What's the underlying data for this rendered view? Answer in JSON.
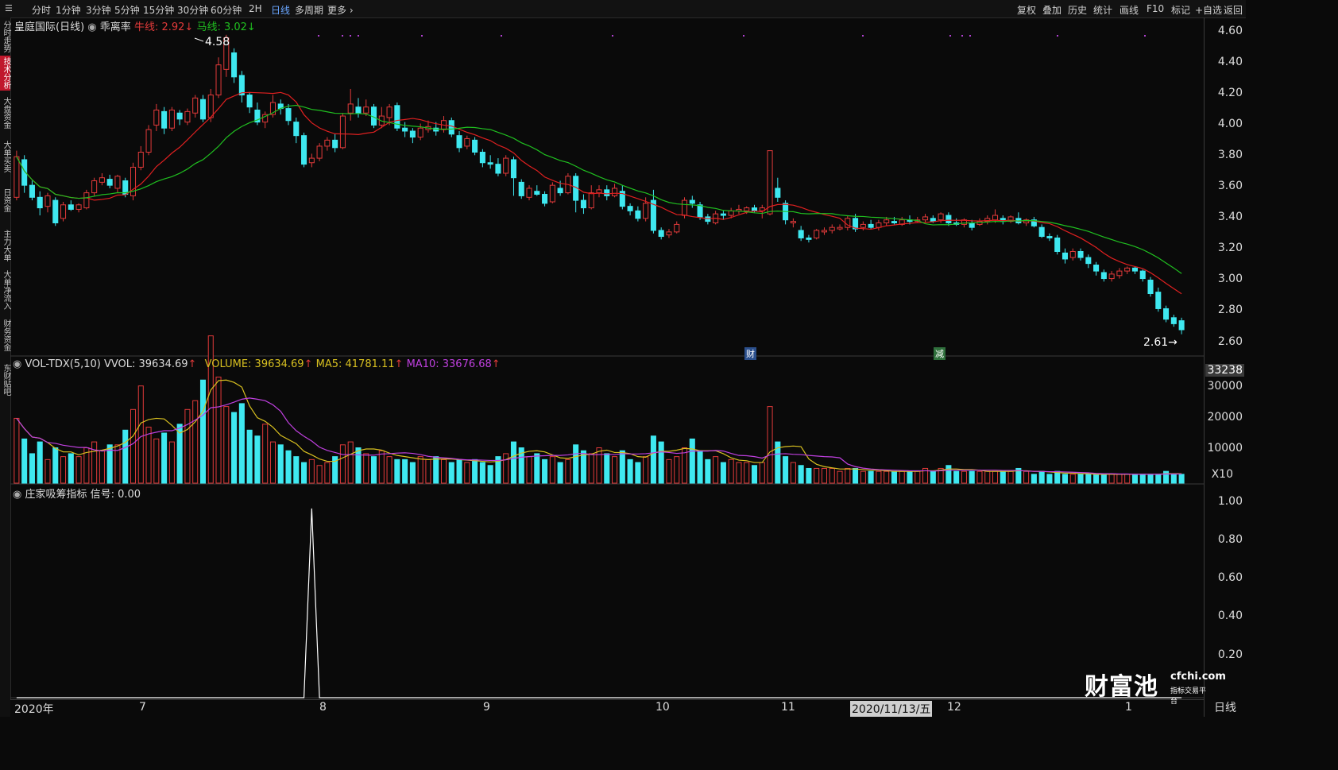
{
  "toolbar": {
    "periods": [
      "分时",
      "1分钟",
      "3分钟",
      "5分钟",
      "15分钟",
      "30分钟",
      "60分钟",
      "2H",
      "日线",
      "多周期",
      "更多"
    ],
    "active_period": "日线",
    "actions": [
      "复权",
      "叠加",
      "历史",
      "统计",
      "画线",
      "F10",
      "标记",
      "+自选",
      "返回"
    ]
  },
  "sidebar": {
    "items": [
      "分时走势",
      "技术分析",
      "大盘资金",
      "大单买卖",
      "日资金",
      "主力大单",
      "大单净流入",
      "财务资金",
      "东财贴吧"
    ],
    "active": "技术分析"
  },
  "main_pane": {
    "stock_title": "皇庭国际(日线)",
    "indicator_name": "乖离率",
    "bull_label": "牛线: 2.92",
    "bull_arrow": "↓",
    "horse_label": "马线: 3.02",
    "horse_arrow": "↓",
    "high_marker": "4.58",
    "low_marker": "2.61",
    "event_badge_1": "财",
    "event_badge_2": "减"
  },
  "volume_pane": {
    "label_main": "VOL-TDX(5,10) VVOL: 39634.69",
    "label_volume": "VOLUME: 39634.69",
    "label_ma5": "MA5: 41781.11",
    "label_ma10": "MA10: 33676.68",
    "up_arrow": "↑",
    "axis_top_value": "33238",
    "axis_labels": [
      "30000",
      "20000",
      "10000",
      "X10"
    ]
  },
  "signal_pane": {
    "label": "庄家吸筹指标 信号: 0.00",
    "axis_labels": [
      "1.00",
      "0.80",
      "0.60",
      "0.40",
      "0.20"
    ]
  },
  "price_axis": [
    "4.60",
    "4.40",
    "4.20",
    "4.00",
    "3.80",
    "3.60",
    "3.40",
    "3.20",
    "3.00",
    "2.80",
    "2.60"
  ],
  "date_axis": [
    "2020年",
    "7",
    "8",
    "9",
    "10",
    "11",
    "12",
    "1"
  ],
  "date_cursor": "2020/11/13/五",
  "right_tab": "日线",
  "watermark": {
    "brand": "财富池",
    "url": "cfchi.com",
    "tagline": "指标交易平台"
  },
  "colors": {
    "up": "#e23a3a",
    "down": "#3fe8f0",
    "ma_short": "#e02020",
    "ma_long": "#20c020",
    "vol_ma5": "#d8c020",
    "vol_ma10": "#c040e0"
  },
  "chart_data": {
    "type": "candlestick",
    "price_range": [
      2.55,
      4.62
    ],
    "bull_line_last": 2.92,
    "horse_line_last": 3.02,
    "candles": [
      [
        3.52,
        3.79,
        3.83,
        3.5
      ],
      [
        3.77,
        3.6,
        3.8,
        3.55
      ],
      [
        3.6,
        3.52,
        3.63,
        3.5
      ],
      [
        3.52,
        3.45,
        3.56,
        3.4
      ],
      [
        3.46,
        3.53,
        3.55,
        3.42
      ],
      [
        3.5,
        3.35,
        3.52,
        3.33
      ],
      [
        3.38,
        3.47,
        3.49,
        3.36
      ],
      [
        3.47,
        3.44,
        3.5,
        3.43
      ],
      [
        3.44,
        3.47,
        3.48,
        3.42
      ],
      [
        3.45,
        3.55,
        3.57,
        3.44
      ],
      [
        3.55,
        3.63,
        3.65,
        3.53
      ],
      [
        3.62,
        3.65,
        3.68,
        3.6
      ],
      [
        3.64,
        3.6,
        3.67,
        3.58
      ],
      [
        3.58,
        3.66,
        3.67,
        3.55
      ],
      [
        3.63,
        3.54,
        3.65,
        3.52
      ],
      [
        3.53,
        3.72,
        3.75,
        3.5
      ],
      [
        3.72,
        3.82,
        3.86,
        3.7
      ],
      [
        3.82,
        3.97,
        4.0,
        3.8
      ],
      [
        4.0,
        4.1,
        4.14,
        3.96
      ],
      [
        4.09,
        3.98,
        4.12,
        3.94
      ],
      [
        3.98,
        4.1,
        4.12,
        3.96
      ],
      [
        4.08,
        4.04,
        4.1,
        4.0
      ],
      [
        4.02,
        4.09,
        4.11,
        4.0
      ],
      [
        4.08,
        4.18,
        4.2,
        4.05
      ],
      [
        4.17,
        4.04,
        4.2,
        4.02
      ],
      [
        4.05,
        4.2,
        4.24,
        4.02
      ],
      [
        4.2,
        4.4,
        4.45,
        4.18
      ],
      [
        4.37,
        4.58,
        4.6,
        4.32
      ],
      [
        4.48,
        4.32,
        4.51,
        4.28
      ],
      [
        4.33,
        4.2,
        4.36,
        4.15
      ],
      [
        4.2,
        4.12,
        4.22,
        4.08
      ],
      [
        4.1,
        4.02,
        4.15,
        4.0
      ],
      [
        4.02,
        4.07,
        4.09,
        3.98
      ],
      [
        4.07,
        4.15,
        4.2,
        4.05
      ],
      [
        4.14,
        4.11,
        4.17,
        4.07
      ],
      [
        4.11,
        4.03,
        4.14,
        4.0
      ],
      [
        4.02,
        3.93,
        4.05,
        3.88
      ],
      [
        3.93,
        3.74,
        3.95,
        3.72
      ],
      [
        3.75,
        3.78,
        3.81,
        3.72
      ],
      [
        3.78,
        3.86,
        3.88,
        3.76
      ],
      [
        3.86,
        3.9,
        3.92,
        3.83
      ],
      [
        3.9,
        3.85,
        3.94,
        3.82
      ],
      [
        3.85,
        4.06,
        4.08,
        3.84
      ],
      [
        4.08,
        4.14,
        4.24,
        4.03
      ],
      [
        4.12,
        4.08,
        4.18,
        4.05
      ],
      [
        4.08,
        4.12,
        4.17,
        4.06
      ],
      [
        4.12,
        4.0,
        4.14,
        3.98
      ],
      [
        4.0,
        4.06,
        4.12,
        3.98
      ],
      [
        4.05,
        4.12,
        4.14,
        4.0
      ],
      [
        4.13,
        3.98,
        4.15,
        3.96
      ],
      [
        3.98,
        3.96,
        4.02,
        3.92
      ],
      [
        3.96,
        3.92,
        3.98,
        3.88
      ],
      [
        3.92,
        3.98,
        4.01,
        3.9
      ],
      [
        3.97,
        3.99,
        4.03,
        3.95
      ],
      [
        3.98,
        3.96,
        4.02,
        3.93
      ],
      [
        3.97,
        4.03,
        4.06,
        3.95
      ],
      [
        4.03,
        3.94,
        4.05,
        3.92
      ],
      [
        3.93,
        3.85,
        3.96,
        3.82
      ],
      [
        3.86,
        3.91,
        3.93,
        3.84
      ],
      [
        3.9,
        3.82,
        3.92,
        3.8
      ],
      [
        3.82,
        3.75,
        3.84,
        3.72
      ],
      [
        3.75,
        3.74,
        3.8,
        3.71
      ],
      [
        3.74,
        3.68,
        3.78,
        3.66
      ],
      [
        3.68,
        3.78,
        3.8,
        3.66
      ],
      [
        3.77,
        3.65,
        3.79,
        3.53
      ],
      [
        3.62,
        3.53,
        3.64,
        3.51
      ],
      [
        3.52,
        3.58,
        3.6,
        3.5
      ],
      [
        3.56,
        3.54,
        3.6,
        3.53
      ],
      [
        3.54,
        3.48,
        3.56,
        3.46
      ],
      [
        3.49,
        3.6,
        3.62,
        3.48
      ],
      [
        3.58,
        3.55,
        3.63,
        3.53
      ],
      [
        3.55,
        3.66,
        3.68,
        3.54
      ],
      [
        3.66,
        3.5,
        3.68,
        3.42
      ],
      [
        3.5,
        3.45,
        3.54,
        3.41
      ],
      [
        3.45,
        3.55,
        3.6,
        3.44
      ],
      [
        3.55,
        3.57,
        3.6,
        3.52
      ],
      [
        3.57,
        3.53,
        3.6,
        3.5
      ],
      [
        3.53,
        3.58,
        3.61,
        3.52
      ],
      [
        3.56,
        3.46,
        3.6,
        3.44
      ],
      [
        3.46,
        3.43,
        3.48,
        3.4
      ],
      [
        3.43,
        3.38,
        3.46,
        3.36
      ],
      [
        3.38,
        3.48,
        3.52,
        3.36
      ],
      [
        3.5,
        3.3,
        3.57,
        3.28
      ],
      [
        3.3,
        3.26,
        3.32,
        3.24
      ],
      [
        3.27,
        3.29,
        3.31,
        3.25
      ],
      [
        3.29,
        3.34,
        3.36,
        3.28
      ],
      [
        3.4,
        3.5,
        3.52,
        3.38
      ],
      [
        3.5,
        3.48,
        3.53,
        3.45
      ],
      [
        3.47,
        3.39,
        3.49,
        3.37
      ],
      [
        3.39,
        3.36,
        3.41,
        3.34
      ],
      [
        3.35,
        3.41,
        3.43,
        3.34
      ],
      [
        3.41,
        3.4,
        3.43,
        3.37
      ],
      [
        3.4,
        3.43,
        3.45,
        3.38
      ],
      [
        3.43,
        3.44,
        3.47,
        3.41
      ],
      [
        3.43,
        3.45,
        3.46,
        3.41
      ],
      [
        3.45,
        3.43,
        3.47,
        3.42
      ],
      [
        3.43,
        3.45,
        3.47,
        3.38
      ],
      [
        3.41,
        3.83,
        3.83,
        3.4
      ],
      [
        3.58,
        3.52,
        3.65,
        3.49
      ],
      [
        3.48,
        3.37,
        3.5,
        3.34
      ],
      [
        3.35,
        3.36,
        3.38,
        3.32
      ],
      [
        3.3,
        3.25,
        3.33,
        3.23
      ],
      [
        3.25,
        3.24,
        3.27,
        3.22
      ],
      [
        3.25,
        3.3,
        3.31,
        3.24
      ],
      [
        3.29,
        3.3,
        3.32,
        3.27
      ],
      [
        3.3,
        3.32,
        3.34,
        3.28
      ],
      [
        3.31,
        3.32,
        3.34,
        3.3
      ],
      [
        3.32,
        3.38,
        3.4,
        3.3
      ],
      [
        3.38,
        3.31,
        3.41,
        3.29
      ],
      [
        3.32,
        3.34,
        3.36,
        3.3
      ],
      [
        3.34,
        3.32,
        3.37,
        3.31
      ],
      [
        3.32,
        3.35,
        3.37,
        3.3
      ],
      [
        3.35,
        3.37,
        3.39,
        3.33
      ],
      [
        3.36,
        3.35,
        3.39,
        3.34
      ],
      [
        3.34,
        3.37,
        3.39,
        3.33
      ],
      [
        3.37,
        3.36,
        3.4,
        3.34
      ],
      [
        3.36,
        3.37,
        3.39,
        3.35
      ],
      [
        3.37,
        3.39,
        3.41,
        3.35
      ],
      [
        3.38,
        3.36,
        3.4,
        3.35
      ],
      [
        3.37,
        3.41,
        3.42,
        3.35
      ],
      [
        3.4,
        3.35,
        3.42,
        3.33
      ],
      [
        3.35,
        3.34,
        3.38,
        3.33
      ],
      [
        3.34,
        3.37,
        3.38,
        3.32
      ],
      [
        3.35,
        3.32,
        3.37,
        3.3
      ],
      [
        3.34,
        3.36,
        3.38,
        3.33
      ],
      [
        3.36,
        3.38,
        3.4,
        3.34
      ],
      [
        3.37,
        3.4,
        3.44,
        3.35
      ],
      [
        3.38,
        3.36,
        3.4,
        3.34
      ],
      [
        3.36,
        3.39,
        3.4,
        3.35
      ],
      [
        3.38,
        3.35,
        3.42,
        3.34
      ],
      [
        3.35,
        3.37,
        3.38,
        3.33
      ],
      [
        3.37,
        3.33,
        3.39,
        3.32
      ],
      [
        3.32,
        3.26,
        3.34,
        3.25
      ],
      [
        3.26,
        3.25,
        3.28,
        3.23
      ],
      [
        3.25,
        3.16,
        3.27,
        3.14
      ],
      [
        3.15,
        3.11,
        3.18,
        3.08
      ],
      [
        3.12,
        3.16,
        3.18,
        3.1
      ],
      [
        3.16,
        3.12,
        3.18,
        3.1
      ],
      [
        3.12,
        3.08,
        3.14,
        3.05
      ],
      [
        3.07,
        3.03,
        3.09,
        3.0
      ],
      [
        3.02,
        2.98,
        3.04,
        2.96
      ],
      [
        2.98,
        3.01,
        3.03,
        2.96
      ],
      [
        3.0,
        3.03,
        3.05,
        2.98
      ],
      [
        3.03,
        3.05,
        3.06,
        3.01
      ],
      [
        3.05,
        3.03,
        3.06,
        3.01
      ],
      [
        3.03,
        2.98,
        3.04,
        2.96
      ],
      [
        2.97,
        2.88,
        2.99,
        2.86
      ],
      [
        2.89,
        2.78,
        2.92,
        2.76
      ],
      [
        2.78,
        2.71,
        2.8,
        2.69
      ],
      [
        2.72,
        2.68,
        2.74,
        2.66
      ],
      [
        2.7,
        2.64,
        2.72,
        2.61
      ]
    ],
    "volume_max": 33238,
    "volumes": [
      22000,
      15000,
      10000,
      14000,
      8000,
      12000,
      9000,
      10000,
      9000,
      12000,
      14000,
      11000,
      13000,
      13000,
      18000,
      25000,
      33000,
      19000,
      15000,
      17000,
      14000,
      20000,
      25000,
      28000,
      35000,
      50000,
      36000,
      26000,
      24000,
      27000,
      18000,
      16000,
      20000,
      14000,
      13000,
      11000,
      9000,
      7000,
      8000,
      6000,
      7000,
      9000,
      13000,
      14000,
      12000,
      10000,
      9000,
      11000,
      9000,
      8000,
      8000,
      7000,
      9000,
      8000,
      9000,
      8000,
      7000,
      8000,
      7000,
      8000,
      7000,
      6000,
      9000,
      10000,
      14000,
      12000,
      9000,
      10000,
      8000,
      9000,
      7000,
      8000,
      13000,
      11000,
      10000,
      12000,
      10000,
      9000,
      11000,
      8000,
      7000,
      9000,
      16000,
      14000,
      8000,
      9000,
      12000,
      15000,
      11000,
      8000,
      9000,
      7000,
      8000,
      7000,
      7000,
      6000,
      7000,
      26000,
      14000,
      9000,
      7000,
      6000,
      5000,
      5000,
      5000,
      5000,
      4000,
      5000,
      5000,
      4000,
      4000,
      4000,
      4000,
      4000,
      4000,
      4000,
      4000,
      5000,
      4000,
      5000,
      6000,
      4000,
      4000,
      4000,
      4000,
      4000,
      4000,
      4000,
      4000,
      5000,
      4000,
      3000,
      4000,
      3000,
      4000,
      3000,
      3000,
      3000,
      3000,
      3000,
      3000,
      3000,
      3000,
      3000,
      3000,
      3000,
      3000,
      3000,
      4000,
      3000,
      3000
    ],
    "signal_spike_index": 38,
    "signal_range": [
      0,
      1.05
    ]
  }
}
